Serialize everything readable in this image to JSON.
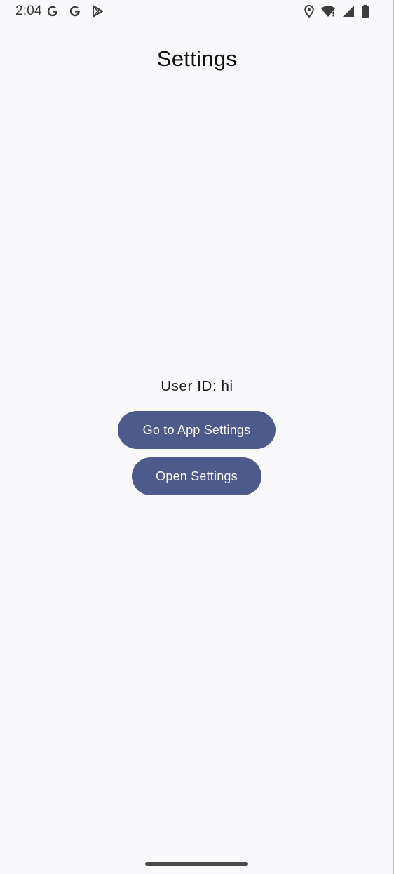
{
  "status_bar": {
    "time": "2:04",
    "left_icons": [
      "google-icon",
      "google-icon",
      "play-store-icon"
    ],
    "right_icons": [
      "location-icon",
      "wifi-icon",
      "signal-icon",
      "battery-icon"
    ]
  },
  "screen": {
    "title": "Settings",
    "user_id_text": "User ID: hi"
  },
  "buttons": {
    "app_settings_label": "Go to App Settings",
    "open_settings_label": "Open Settings"
  },
  "colors": {
    "background": "#f9f9fb",
    "button": "#4d5b8c",
    "button_text": "#ffffff"
  }
}
